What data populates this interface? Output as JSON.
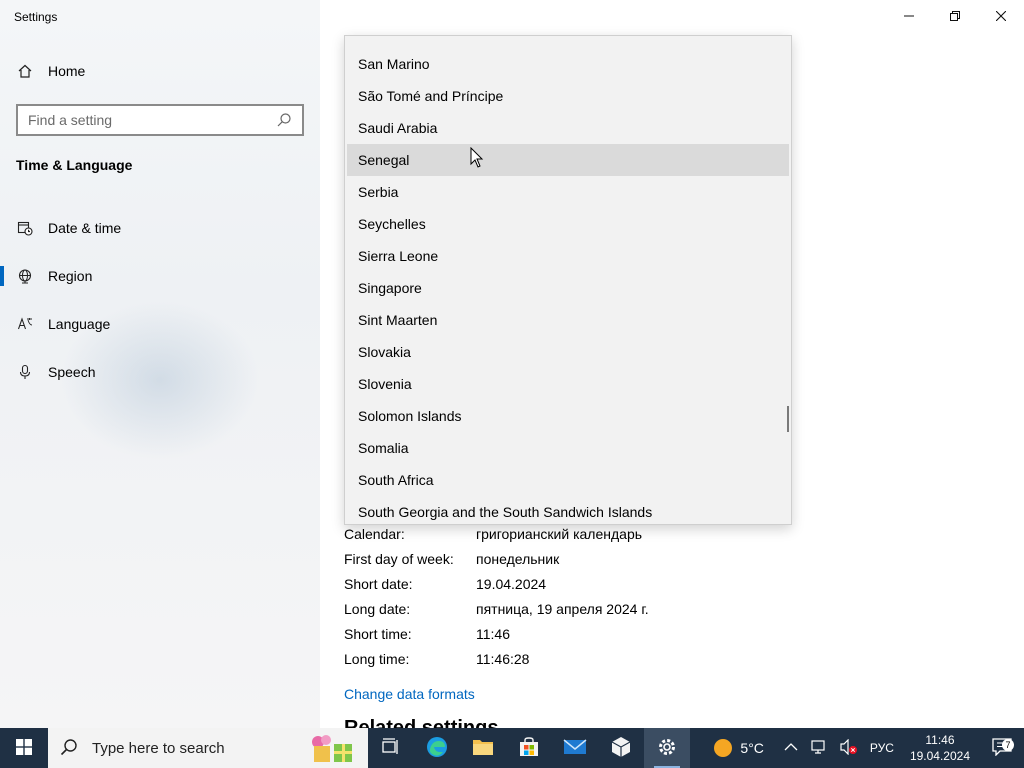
{
  "window": {
    "title": "Settings",
    "controls": [
      "minimize-icon",
      "restore-icon",
      "close-icon"
    ]
  },
  "sidebar": {
    "home_label": "Home",
    "search": {
      "placeholder": "Find a setting",
      "value": ""
    },
    "section_title": "Time & Language",
    "items": [
      {
        "label": "Date & time",
        "icon": "calendar-clock-icon",
        "active": false
      },
      {
        "label": "Region",
        "icon": "globe-icon",
        "active": true
      },
      {
        "label": "Language",
        "icon": "language-icon",
        "active": false
      },
      {
        "label": "Speech",
        "icon": "microphone-icon",
        "active": false
      }
    ]
  },
  "country_dropdown": {
    "hovered": "Senegal",
    "items": [
      "San Marino",
      "São Tomé and Príncipe",
      "Saudi Arabia",
      "Senegal",
      "Serbia",
      "Seychelles",
      "Sierra Leone",
      "Singapore",
      "Sint Maarten",
      "Slovakia",
      "Slovenia",
      "Solomon Islands",
      "Somalia",
      "South Africa",
      "South Georgia and the South Sandwich Islands"
    ]
  },
  "formats": [
    {
      "label": "Calendar:",
      "value": "григорианский календарь"
    },
    {
      "label": "First day of week:",
      "value": "понедельник"
    },
    {
      "label": "Short date:",
      "value": "19.04.2024"
    },
    {
      "label": "Long date:",
      "value": "пятница, 19 апреля 2024 г."
    },
    {
      "label": "Short time:",
      "value": "11:46"
    },
    {
      "label": "Long time:",
      "value": "11:46:28"
    }
  ],
  "change_formats_link": "Change data formats",
  "related_settings_title": "Related settings",
  "taskbar": {
    "search_placeholder": "Type here to search",
    "apps": [
      "task-view-icon",
      "edge-icon",
      "file-explorer-icon",
      "store-icon",
      "mail-icon",
      "package-icon",
      "settings-icon"
    ],
    "weather": "5°C",
    "language": "РУС",
    "time": "11:46",
    "date": "19.04.2024",
    "notification_count": "7"
  },
  "colors": {
    "accent": "#0067c0",
    "taskbar": "#1f3044",
    "dropdown_bg": "#f2f2f2",
    "dropdown_hover": "#dadada"
  }
}
